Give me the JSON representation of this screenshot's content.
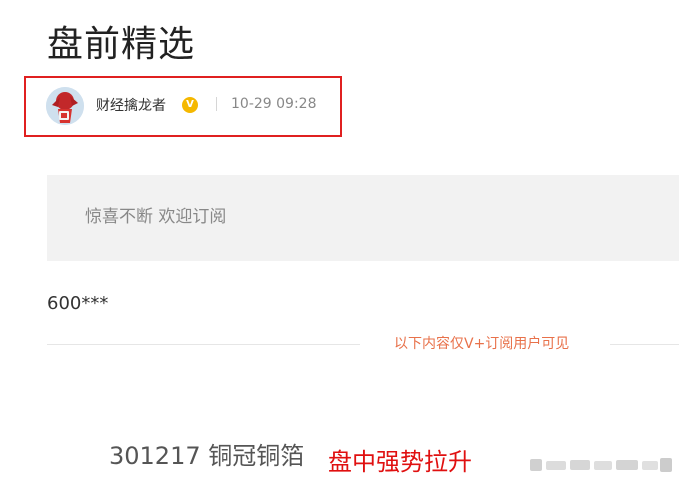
{
  "article": {
    "title": "盘前精选"
  },
  "author": {
    "name": "财经擒龙者",
    "verified_mark": "V",
    "post_time": "10-29 09:28"
  },
  "promo": {
    "text": "惊喜不断 欢迎订阅"
  },
  "content": {
    "stock_code_masked": "600***",
    "vip_notice": "以下内容仅V+订阅用户可见",
    "stock_line": "301217 铜冠铜箔",
    "stock_tag": "盘中强势拉升"
  },
  "colors": {
    "highlight_box": "#e02020",
    "vip_notice": "#e8714a",
    "stock_tag": "#e01010",
    "verified_badge": "#f5b800"
  }
}
